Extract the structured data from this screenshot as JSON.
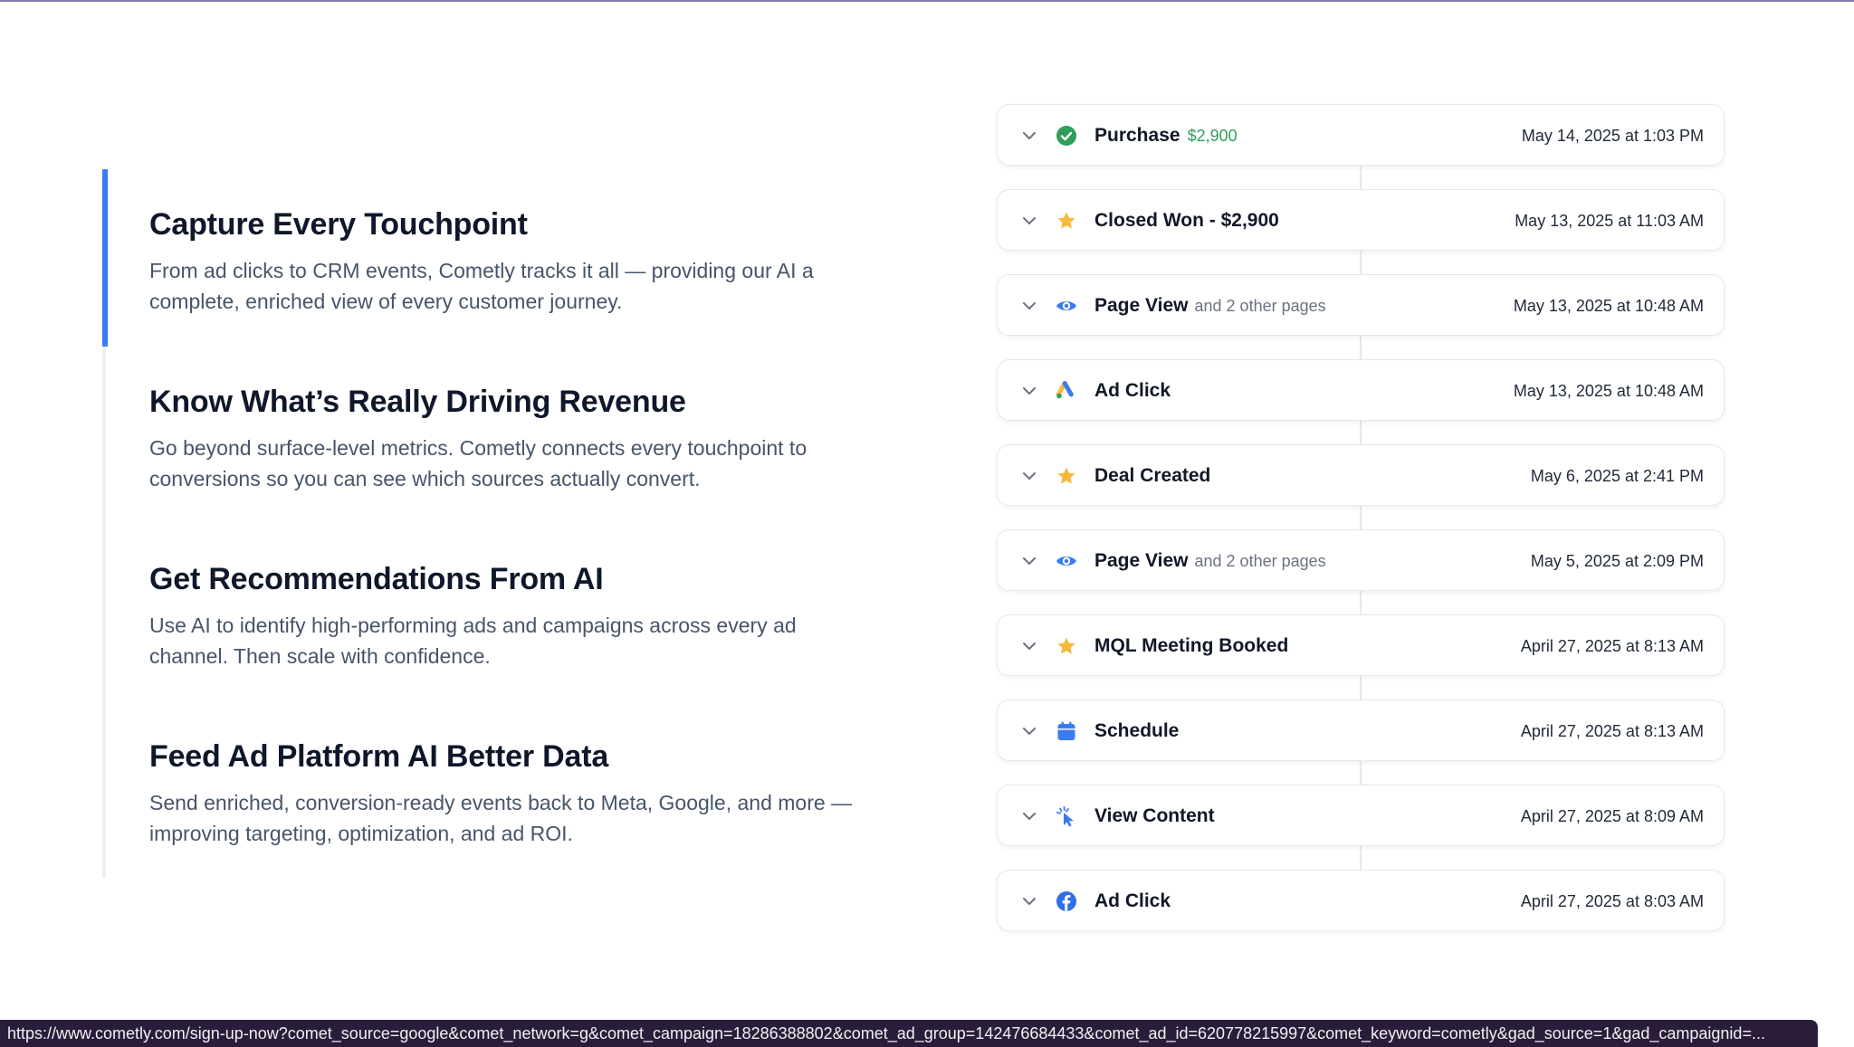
{
  "features": [
    {
      "title": "Capture Every Touchpoint",
      "description": "From ad clicks to CRM events, Cometly tracks it all — providing our AI a complete, enriched view of every customer journey.",
      "active": true
    },
    {
      "title": "Know What’s Really Driving Revenue",
      "description": "Go beyond surface-level metrics. Cometly connects every touchpoint to conversions so you can see which sources actually convert.",
      "active": false
    },
    {
      "title": "Get Recommendations From AI",
      "description": "Use AI to identify high-performing ads and campaigns across every ad channel. Then scale with confidence.",
      "active": false
    },
    {
      "title": "Feed Ad Platform AI Better Data",
      "description": "Send enriched, conversion-ready events back to Meta, Google, and more — improving targeting, optimization, and ad ROI.",
      "active": false
    }
  ],
  "events": [
    {
      "icon": "check-circle-icon",
      "name": "Purchase",
      "amount": "$2,900",
      "extra": "",
      "date": "May 14, 2025 at 1:03 PM"
    },
    {
      "icon": "star-icon",
      "name": "Closed Won - $2,900",
      "amount": "",
      "extra": "",
      "date": "May 13, 2025 at 11:03 AM"
    },
    {
      "icon": "eye-icon",
      "name": "Page View",
      "amount": "",
      "extra": "and 2 other pages",
      "date": "May 13, 2025 at 10:48 AM"
    },
    {
      "icon": "google-ads-icon",
      "name": "Ad Click",
      "amount": "",
      "extra": "",
      "date": "May 13, 2025 at 10:48 AM"
    },
    {
      "icon": "star-icon",
      "name": "Deal Created",
      "amount": "",
      "extra": "",
      "date": "May 6, 2025 at 2:41 PM"
    },
    {
      "icon": "eye-icon",
      "name": "Page View",
      "amount": "",
      "extra": "and 2 other pages",
      "date": "May 5, 2025 at 2:09 PM"
    },
    {
      "icon": "star-icon",
      "name": "MQL Meeting Booked",
      "amount": "",
      "extra": "",
      "date": "April 27, 2025 at 8:13 AM"
    },
    {
      "icon": "calendar-icon",
      "name": "Schedule",
      "amount": "",
      "extra": "",
      "date": "April 27, 2025 at 8:13 AM"
    },
    {
      "icon": "pointer-click-icon",
      "name": "View Content",
      "amount": "",
      "extra": "",
      "date": "April 27, 2025 at 8:09 AM"
    },
    {
      "icon": "facebook-icon",
      "name": "Ad Click",
      "amount": "",
      "extra": "",
      "date": "April 27, 2025 at 8:03 AM"
    }
  ],
  "status_bar": {
    "url": "https://www.cometly.com/sign-up-now?comet_source=google&comet_network=g&comet_campaign=18286388802&comet_ad_group=142476684433&comet_ad_id=620778215997&comet_keyword=cometly&gad_source=1&gad_campaignid=..."
  },
  "colors": {
    "accent": "#3b7bf0",
    "success": "#2f9e5b",
    "star": "#f6b93b",
    "status_bar_bg": "#2a1d3a"
  }
}
